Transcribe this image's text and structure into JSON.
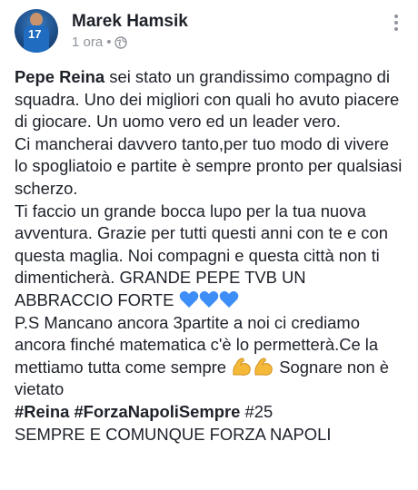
{
  "header": {
    "author_name": "Marek Hamsik",
    "time": "1 ora",
    "separator": "•",
    "avatar_number": "17",
    "icons": [
      "avatar",
      "globe-icon",
      "more-options-icon"
    ]
  },
  "post": {
    "mention": "Pepe Reina",
    "p1_rest": " sei stato un grandissimo compagno di squadra. Uno dei migliori con quali ho avuto piacere di giocare. Un uomo vero ed un leader vero.",
    "p2": "Ci mancherai davvero tanto,per tuo modo di vivere lo spogliatoio e partite è sempre pronto per qualsiasi scherzo.",
    "p3": "Ti faccio un grande bocca lupo per la tua nuova avventura. Grazie per tutti questi anni con te e con questa maglia. Noi compagni e questa città non ti dimenticherà. GRANDE PEPE TVB UN ABBRACCIO FORTE ",
    "p4_a": "P.S Mancano ancora 3partite a noi ci crediamo ancora finché matematica c'è lo permetterà.Ce la mettiamo tutta come sempre ",
    "p4_b": " Sognare non è vietato",
    "hashtag1": "#Reina",
    "hashtag2": "#ForzaNapoliSempre",
    "hashtag3": " #25",
    "last_line": "SEMPRE E COMUNQUE FORZA NAPOLI",
    "emoji_hearts": "blue-heart ×3",
    "emoji_muscles": "flexed-biceps ×2"
  },
  "colors": {
    "text": "#1d2129",
    "meta": "#90949c",
    "heart": "#3e8ef7",
    "muscle": "#f5b93a"
  }
}
